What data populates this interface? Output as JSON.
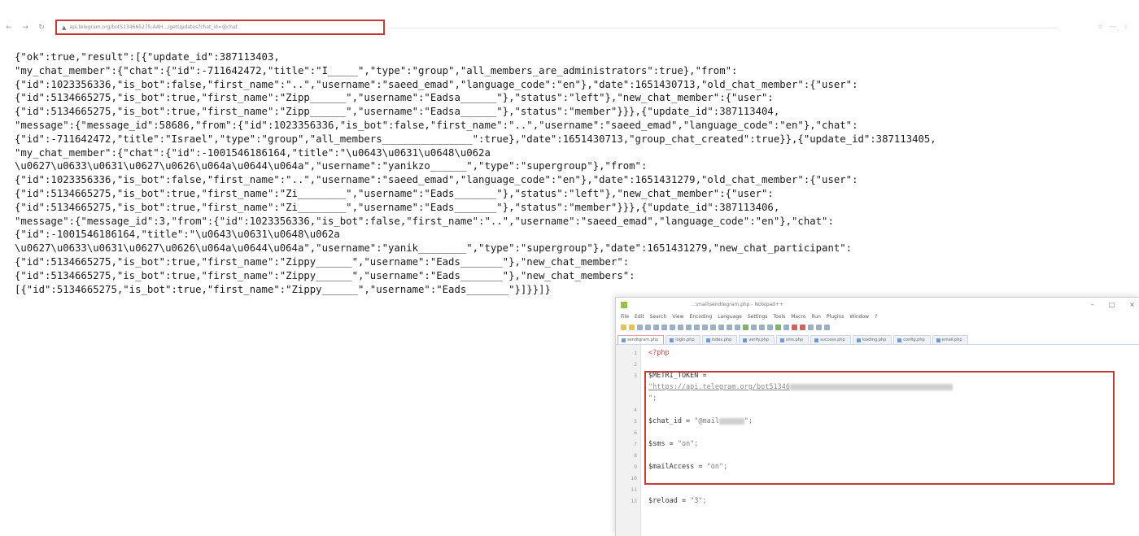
{
  "browser": {
    "nav": [
      "←",
      "→",
      "↻"
    ],
    "url": "api.telegram.org/bot5134665275:AAH…/getUpdates?chat_id=@chat",
    "right_icons": [
      "☆",
      "⋯",
      "⋮"
    ]
  },
  "json_lines": [
    "{\"ok\":true,\"result\":[{\"update_id\":387113403,",
    "\"my_chat_member\":{\"chat\":{\"id\":-711642472,\"title\":\"I_____\",\"type\":\"group\",\"all_members_are_administrators\":true},\"from\":",
    "{\"id\":1023356336,\"is_bot\":false,\"first_name\":\"..\",\"username\":\"saeed_emad\",\"language_code\":\"en\"},\"date\":1651430713,\"old_chat_member\":{\"user\":",
    "{\"id\":5134665275,\"is_bot\":true,\"first_name\":\"Zipp______\",\"username\":\"Eadsa______\"},\"status\":\"left\"},\"new_chat_member\":{\"user\":",
    "{\"id\":5134665275,\"is_bot\":true,\"first_name\":\"Zipp______\",\"username\":\"Eadsa______\"},\"status\":\"member\"}}},{\"update_id\":387113404,",
    "\"message\":{\"message_id\":58686,\"from\":{\"id\":1023356336,\"is_bot\":false,\"first_name\":\"..\",\"username\":\"saeed_emad\",\"language_code\":\"en\"},\"chat\":",
    "{\"id\":-711642472,\"title\":\"Israel\",\"type\":\"group\",\"all_members_______________\":true},\"date\":1651430713,\"group_chat_created\":true}},{\"update_id\":387113405,",
    "\"my_chat_member\":{\"chat\":{\"id\":-1001546186164,\"title\":\"\\u0643\\u0631\\u0648\\u062a",
    "\\u0627\\u0633\\u0631\\u0627\\u0626\\u064a\\u0644\\u064a\",\"username\":\"yanikzo______\",\"type\":\"supergroup\"},\"from\":",
    "{\"id\":1023356336,\"is_bot\":false,\"first_name\":\"..\",\"username\":\"saeed_emad\",\"language_code\":\"en\"},\"date\":1651431279,\"old_chat_member\":{\"user\":",
    "{\"id\":5134665275,\"is_bot\":true,\"first_name\":\"Zi________\",\"username\":\"Eads_______\"},\"status\":\"left\"},\"new_chat_member\":{\"user\":",
    "{\"id\":5134665275,\"is_bot\":true,\"first_name\":\"Zi________\",\"username\":\"Eads_______\"},\"status\":\"member\"}}},{\"update_id\":387113406,",
    "\"message\":{\"message_id\":3,\"from\":{\"id\":1023356336,\"is_bot\":false,\"first_name\":\"..\",\"username\":\"saeed_emad\",\"language_code\":\"en\"},\"chat\":",
    "{\"id\":-1001546186164,\"title\":\"\\u0643\\u0631\\u0648\\u062a",
    "\\u0627\\u0633\\u0631\\u0627\\u0626\\u064a\\u0644\\u064a\",\"username\":\"yanik________\",\"type\":\"supergroup\"},\"date\":1651431279,\"new_chat_participant\":",
    "{\"id\":5134665275,\"is_bot\":true,\"first_name\":\"Zippy______\",\"username\":\"Eads_______\"},\"new_chat_member\":",
    "{\"id\":5134665275,\"is_bot\":true,\"first_name\":\"Zippy______\",\"username\":\"Eads_______\"},\"new_chat_members\":",
    "[{\"id\":5134665275,\"is_bot\":true,\"first_name\":\"Zippy______\",\"username\":\"Eads_______\"}]}}]}"
  ],
  "notepad": {
    "title": "…\\mail\\sendtegram.php - Notepad++",
    "controls": [
      "–",
      "□",
      "×"
    ],
    "menu": [
      "File",
      "Edit",
      "Search",
      "View",
      "Encoding",
      "Language",
      "Settings",
      "Tools",
      "Macro",
      "Run",
      "Plugins",
      "Window",
      "?"
    ],
    "tabs": [
      "sendtgram.php",
      "login.php",
      "index.php",
      "verify.php",
      "sms.php",
      "success.php",
      "loading.php",
      "config.php",
      "email.php"
    ],
    "lines": [
      {
        "n": "1",
        "parts": [
          [
            "k",
            "<?php"
          ]
        ]
      },
      {
        "n": "2",
        "parts": []
      },
      {
        "n": "3",
        "parts": [
          [
            "",
            "$METRI_TOKEN ="
          ]
        ]
      },
      {
        "n": "",
        "parts": [
          [
            "u",
            "\"https://api.telegram.org/bot51346"
          ],
          [
            "b",
            "xxxxxxxxxxxxxxxxxxxxxxxxxxxxxxxxxxxxxxx"
          ]
        ]
      },
      {
        "n": "",
        "parts": [
          [
            "v",
            "\";"
          ]
        ]
      },
      {
        "n": "4",
        "parts": []
      },
      {
        "n": "5",
        "parts": [
          [
            "",
            "$chat_id = "
          ],
          [
            "v",
            "\"@mail"
          ],
          [
            "b",
            "xxxxxx"
          ],
          [
            "v",
            "\";"
          ]
        ]
      },
      {
        "n": "6",
        "parts": []
      },
      {
        "n": "7",
        "parts": [
          [
            "",
            "$sms = "
          ],
          [
            "v",
            "\"on\";"
          ]
        ]
      },
      {
        "n": "8",
        "parts": []
      },
      {
        "n": "9",
        "parts": [
          [
            "",
            "$mailAccess = "
          ],
          [
            "v",
            "\"on\";"
          ]
        ]
      },
      {
        "n": "10",
        "parts": []
      },
      {
        "n": "11",
        "parts": []
      },
      {
        "n": "12",
        "parts": [
          [
            "",
            "$reload = "
          ],
          [
            "v",
            "\"3\";"
          ]
        ]
      }
    ]
  }
}
